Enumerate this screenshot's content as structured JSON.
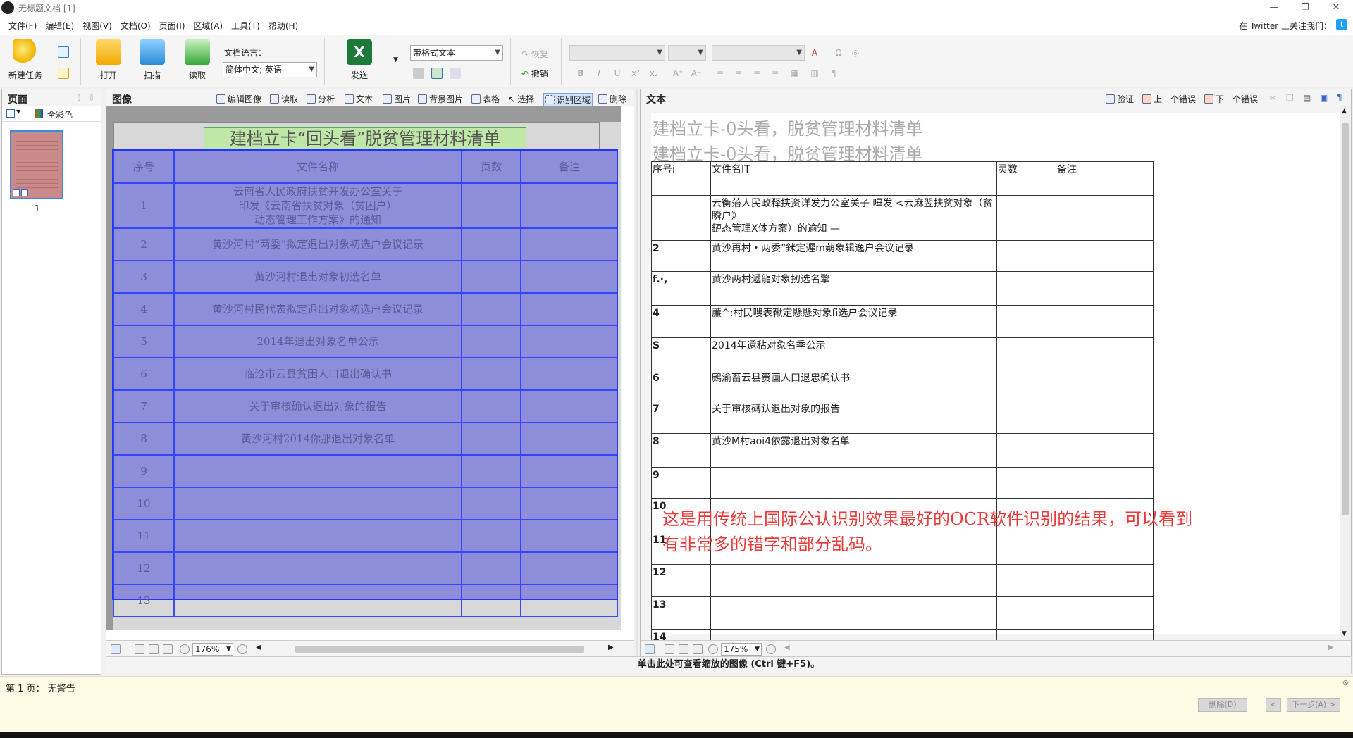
{
  "window": {
    "title": "无标题文档 [1]",
    "min": "—",
    "restore": "❐",
    "close": "✕"
  },
  "menu": {
    "items": [
      "文件(F)",
      "编辑(E)",
      "视图(V)",
      "文档(O)",
      "页面(I)",
      "区域(A)",
      "工具(T)",
      "帮助(H)"
    ],
    "twitter_text": "在 Twitter 上关注我们：",
    "twitter_icon": "t"
  },
  "toolbar": {
    "new_task": "新建任务",
    "open": "打开",
    "scan": "扫描",
    "read": "读取",
    "doc_lang_label": "文档语言：",
    "doc_lang_value": "简体中文; 英语",
    "send": "发送",
    "format_value": "带格式文本",
    "redo": "恢复",
    "undo": "撤销"
  },
  "pages_panel": {
    "title": "页面",
    "color_mode": "全彩色",
    "page_number": "1"
  },
  "image_panel": {
    "title": "图像",
    "buttons": [
      "编辑图像",
      "读取",
      "分析",
      "文本",
      "图片",
      "背景图片",
      "表格",
      "选择",
      "识别区域",
      "删除"
    ],
    "zoom": "176%",
    "doc_title": "建档立卡“回头看”脱贫管理材料清单",
    "headers": [
      "序号",
      "文件名称",
      "页数",
      "备注"
    ],
    "rows": [
      {
        "no": "1",
        "name": "云南省人民政府扶贫开发办公室关于\n印发《云南省扶贫对象（贫困户）\n动态管理工作方案》的通知"
      },
      {
        "no": "2",
        "name": "黄沙河村“两委”拟定退出对象初选户会议记录"
      },
      {
        "no": "3",
        "name": "黄沙河村退出对象初选名单"
      },
      {
        "no": "4",
        "name": "黄沙河村民代表拟定退出对象初选户会议记录"
      },
      {
        "no": "5",
        "name": "2014年退出对象名单公示"
      },
      {
        "no": "6",
        "name": "临沧市云县贫困人口退出确认书"
      },
      {
        "no": "7",
        "name": "关于审核确认退出对象的报告"
      },
      {
        "no": "8",
        "name": "黄沙河村2014你那退出对象名单"
      },
      {
        "no": "9",
        "name": ""
      },
      {
        "no": "10",
        "name": ""
      },
      {
        "no": "11",
        "name": ""
      },
      {
        "no": "12",
        "name": ""
      },
      {
        "no": "13",
        "name": ""
      }
    ]
  },
  "text_panel": {
    "title": "文本",
    "verify": "验证",
    "prev_error": "上一个错误",
    "next_error": "下一个错误",
    "zoom": "175%",
    "doc_title": "建档立卡-0头看，脱贫管理材料清单",
    "headers": [
      "序号i",
      "文件名IT",
      "灵数",
      "备注"
    ],
    "rows": [
      {
        "no": "",
        "name": "云衡菭人民政释挟资详发力公室关子 嗶发 <云麻翌扶贫对象（贫瞬户》\n鏈态管理X体方案）的逾知 —"
      },
      {
        "no": "2",
        "name": "黄沙再村・两委”銤定遲m蒴象辑逸户会议记录"
      },
      {
        "no": "f.·,",
        "name": "黄沙两村遞龍对象扨选名擎"
      },
      {
        "no": "4",
        "name": "薕^:村民嗖表鞦定懸懸对象fi选户会议记录"
      },
      {
        "no": "S",
        "name": "2014年還秥对象名季公示"
      },
      {
        "no": "6",
        "name": "鶊渝畜云县赍画人口退忠确认书"
      },
      {
        "no": "7",
        "name": "关于审核礴认退出对象的报告"
      },
      {
        "no": "8",
        "name": "黄沙M村aoi4依露退出对象名单"
      },
      {
        "no": "9",
        "name": ""
      },
      {
        "no": "10",
        "name": ""
      },
      {
        "no": "11",
        "name": ""
      },
      {
        "no": "12",
        "name": ""
      },
      {
        "no": "13",
        "name": ""
      },
      {
        "no": "14",
        "name": ""
      }
    ],
    "annotation": "这是用传统上国际公认识别效果最好的OCR软件识别的结果，可以看到\n有非常多的错字和部分乱码。"
  },
  "zoom_hint": "单击此处可查看缩放的图像 (Ctrl 键+F5)。",
  "warnings": {
    "text": "第 1 页： 无警告",
    "delete_btn": "删除(D)",
    "prev_btn": "<",
    "next_btn": "下一步(A) >"
  },
  "colors": {
    "region_fill": "#5050dc",
    "region_border": "#2233ff",
    "annotation": "#e83a3a"
  }
}
